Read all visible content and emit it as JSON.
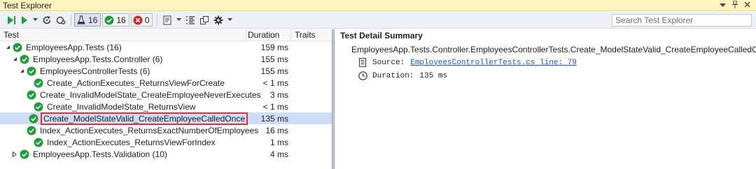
{
  "window": {
    "title": "Test Explorer",
    "pin_icon": "pin-icon",
    "close_icon": "close-icon"
  },
  "toolbar": {
    "run_all_icon": "run-all-icon",
    "run_icon": "run-icon",
    "refresh_icon": "refresh-icon",
    "cancel_icon": "cancel-icon",
    "total_count": "16",
    "passed_count": "16",
    "failed_count": "0",
    "playlist_icon": "playlist-icon",
    "group_icon": "group-by-icon",
    "copy_icon": "copy-icon",
    "settings_icon": "gear-icon",
    "search_placeholder": "Search Test Explorer",
    "search_icon": "search-icon"
  },
  "tree": {
    "columns": [
      "Test",
      "Duration",
      "Traits"
    ],
    "rows": [
      {
        "name": "EmployeesApp.Tests (16)",
        "duration": "159 ms",
        "level": 0,
        "expander": "expanded"
      },
      {
        "name": "EmployeesApp.Tests.Controller (6)",
        "duration": "155 ms",
        "level": 1,
        "expander": "expanded"
      },
      {
        "name": "EmployeesControllerTests (6)",
        "duration": "155 ms",
        "level": 2,
        "expander": "expanded"
      },
      {
        "name": "Create_ActionExecutes_ReturnsViewForCreate",
        "duration": "< 1 ms",
        "level": 3,
        "expander": "none"
      },
      {
        "name": "Create_InvalidModelState_CreateEmployeeNeverExecutes",
        "duration": "3 ms",
        "level": 3,
        "expander": "none"
      },
      {
        "name": "Create_InvalidModelState_ReturnsView",
        "duration": "< 1 ms",
        "level": 3,
        "expander": "none"
      },
      {
        "name": "Create_ModelStateValid_CreateEmployeeCalledOnce",
        "duration": "135 ms",
        "level": 3,
        "expander": "none",
        "selected": true
      },
      {
        "name": "Index_ActionExecutes_ReturnsExactNumberOfEmployees",
        "duration": "16 ms",
        "level": 3,
        "expander": "none"
      },
      {
        "name": "Index_ActionExecutes_ReturnsViewForIndex",
        "duration": "1 ms",
        "level": 3,
        "expander": "none"
      },
      {
        "name": "EmployeesApp.Tests.Validation (10)",
        "duration": "4 ms",
        "level": 1,
        "expander": "collapsed"
      }
    ]
  },
  "detail": {
    "heading": "Test Detail Summary",
    "test_full_name": "EmployeesApp.Tests.Controller.EmployeesControllerTests.Create_ModelStateValid_CreateEmployeeCalledOnce",
    "source_label": "Source:",
    "source_link": "EmployeesControllerTests.cs line: 79",
    "duration_label": "Duration:",
    "duration_value": "135 ms"
  },
  "colors": {
    "pass_green": "#1f9d3b",
    "fail_red": "#d7262b",
    "selection": "#cfdcf5",
    "highlight_box": "#e0303a",
    "link": "#1a54c9"
  }
}
